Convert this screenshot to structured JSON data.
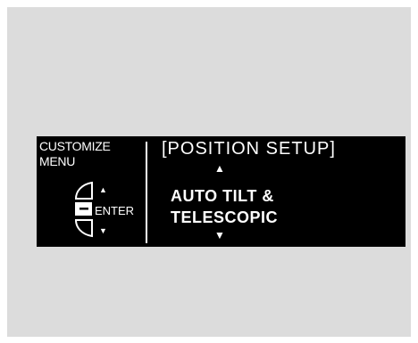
{
  "sidebar": {
    "title_line1": "CUSTOMIZE",
    "title_line2": "MENU",
    "enter_label": "ENTER",
    "up_glyph": "▲",
    "down_glyph": "▼",
    "dial_icon": "selector-dial-icon"
  },
  "main": {
    "title": "[POSITION SETUP]",
    "up_glyph": "▲",
    "down_glyph": "▼",
    "option_line1": "AUTO TILT &",
    "option_line2": "TELESCOPIC"
  },
  "colors": {
    "background": "#dcdcdc",
    "display": "#000000",
    "text": "#ffffff"
  }
}
